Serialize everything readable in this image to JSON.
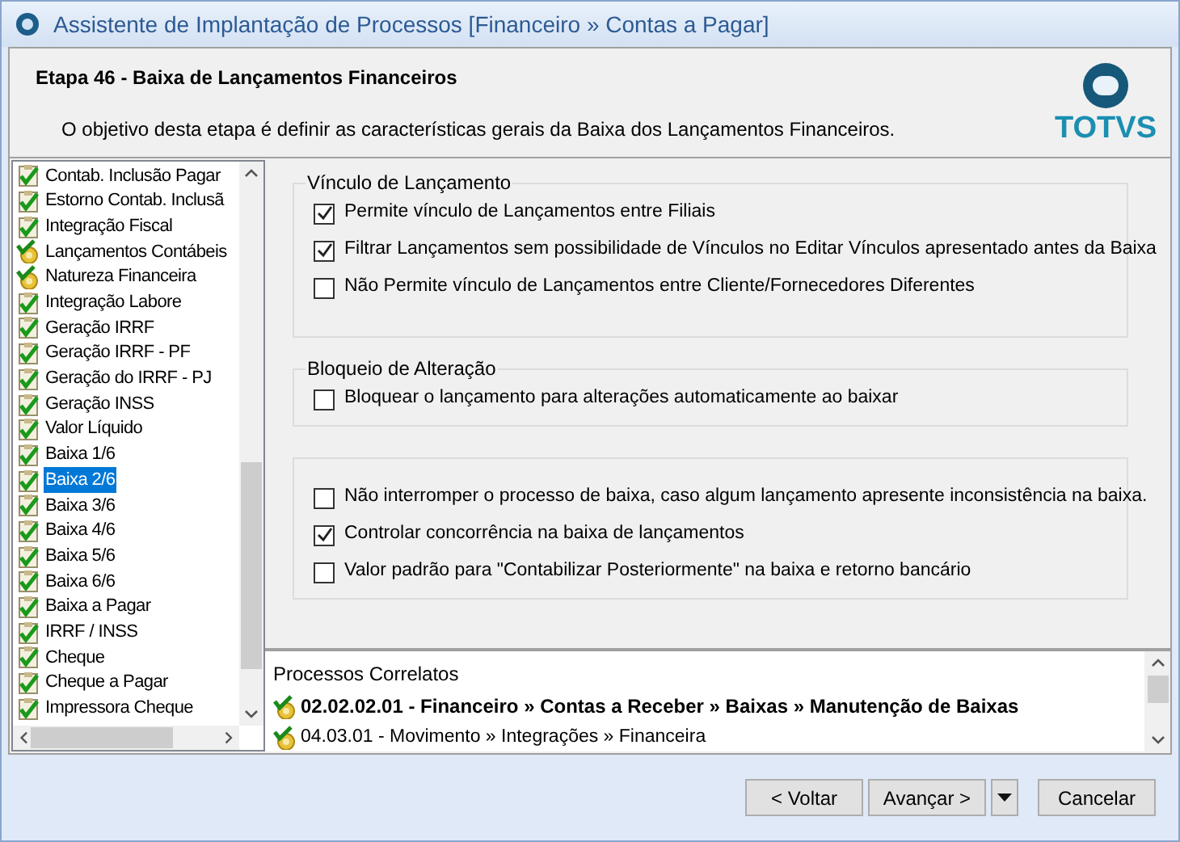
{
  "window": {
    "title": "Assistente de Implantação de Processos [Financeiro » Contas a Pagar]"
  },
  "header": {
    "title": "Etapa 46 - Baixa de Lançamentos Financeiros",
    "description": "O objetivo desta etapa é definir as características gerais da Baixa dos Lançamentos Financeiros.",
    "logo": "TOTVS"
  },
  "steps": [
    {
      "label": "Contab. Inclusão Pagar",
      "kind": "check",
      "selected": false
    },
    {
      "label": "Estorno Contab. Inclusã",
      "kind": "check",
      "selected": false
    },
    {
      "label": "Integração Fiscal",
      "kind": "check",
      "selected": false
    },
    {
      "label": "Lançamentos Contábeis",
      "kind": "gear",
      "selected": false
    },
    {
      "label": "Natureza Financeira",
      "kind": "gear",
      "selected": false
    },
    {
      "label": "Integração Labore",
      "kind": "check",
      "selected": false
    },
    {
      "label": "Geração IRRF",
      "kind": "check",
      "selected": false
    },
    {
      "label": "Geração IRRF - PF",
      "kind": "check",
      "selected": false
    },
    {
      "label": "Geração do IRRF - PJ",
      "kind": "check",
      "selected": false
    },
    {
      "label": "Geração INSS",
      "kind": "check",
      "selected": false
    },
    {
      "label": "Valor Líquido",
      "kind": "check",
      "selected": false
    },
    {
      "label": "Baixa 1/6",
      "kind": "check",
      "selected": false
    },
    {
      "label": "Baixa 2/6",
      "kind": "check",
      "selected": true
    },
    {
      "label": "Baixa 3/6",
      "kind": "check",
      "selected": false
    },
    {
      "label": "Baixa 4/6",
      "kind": "check",
      "selected": false
    },
    {
      "label": "Baixa 5/6",
      "kind": "check",
      "selected": false
    },
    {
      "label": "Baixa 6/6",
      "kind": "check",
      "selected": false
    },
    {
      "label": "Baixa a Pagar",
      "kind": "check",
      "selected": false
    },
    {
      "label": "IRRF / INSS",
      "kind": "check",
      "selected": false
    },
    {
      "label": "Cheque",
      "kind": "check",
      "selected": false
    },
    {
      "label": "Cheque a Pagar",
      "kind": "check",
      "selected": false
    },
    {
      "label": "Impressora Cheque",
      "kind": "check",
      "selected": false
    }
  ],
  "groups": [
    {
      "title": "Vínculo de Lançamento",
      "options": [
        {
          "label": "Permite vínculo de Lançamentos entre Filiais",
          "checked": true
        },
        {
          "label": "Filtrar Lançamentos sem possibilidade de Vínculos no Editar Vínculos apresentado antes da Baixa",
          "checked": true
        },
        {
          "label": "Não Permite vínculo de Lançamentos entre Cliente/Fornecedores Diferentes",
          "checked": false
        }
      ]
    },
    {
      "title": "Bloqueio de Alteração",
      "options": [
        {
          "label": "Bloquear o lançamento para alterações automaticamente ao baixar",
          "checked": false
        }
      ]
    },
    {
      "options": [
        {
          "label": "Não interromper o processo de baixa, caso algum lançamento apresente inconsistência na baixa.",
          "checked": false
        },
        {
          "label": "Controlar concorrência na baixa de lançamentos",
          "checked": true
        },
        {
          "label": "Valor padrão para \"Contabilizar Posteriormente\" na baixa e retorno bancário",
          "checked": false
        }
      ]
    }
  ],
  "related": {
    "title": "Processos Correlatos",
    "items": [
      {
        "label": "02.02.02.01 - Financeiro » Contas a Receber » Baixas » Manutenção de Baixas",
        "bold": true
      },
      {
        "label": "04.03.01 - Movimento » Integrações » Financeira",
        "bold": false
      }
    ]
  },
  "buttons": {
    "back": "< Voltar",
    "next": "Avançar >",
    "cancel": "Cancelar"
  }
}
